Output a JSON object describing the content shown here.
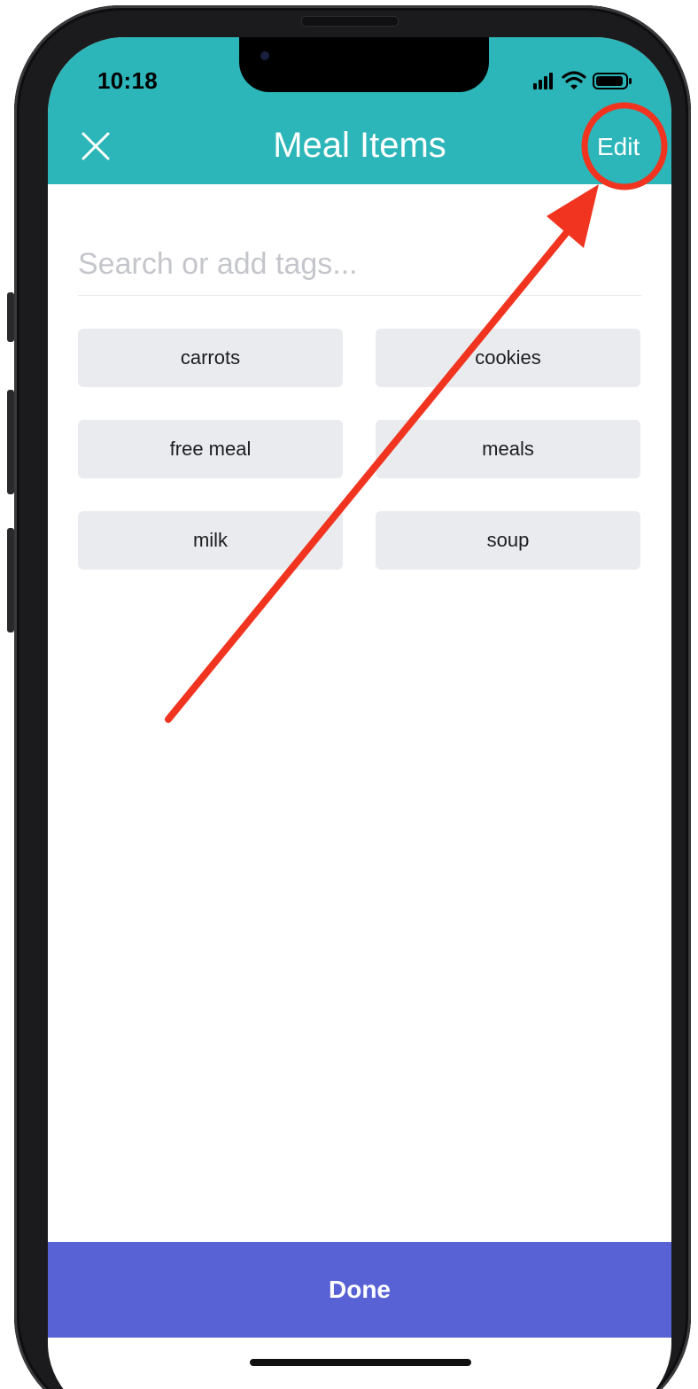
{
  "status_bar": {
    "time": "10:18"
  },
  "nav": {
    "title": "Meal Items",
    "edit_label": "Edit",
    "close_icon": "close-icon"
  },
  "search": {
    "placeholder": "Search or add tags...",
    "value": ""
  },
  "tags": [
    {
      "label": "carrots"
    },
    {
      "label": "cookies"
    },
    {
      "label": "free meal"
    },
    {
      "label": "meals"
    },
    {
      "label": "milk"
    },
    {
      "label": "soup"
    }
  ],
  "footer": {
    "done_label": "Done"
  },
  "colors": {
    "nav_bg": "#2cb6b9",
    "done_bg": "#5862d5",
    "chip_bg": "#e9ebef",
    "annotation_red": "#f0341f"
  },
  "annotation": {
    "type": "arrow-and-circle",
    "target": "edit-button"
  }
}
